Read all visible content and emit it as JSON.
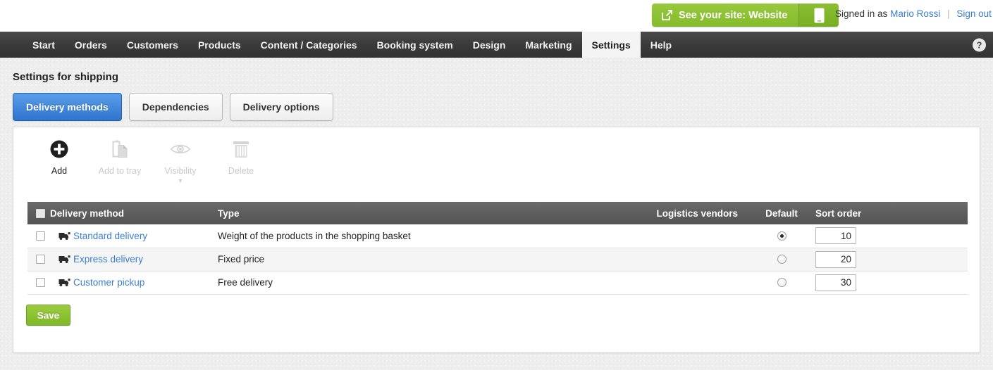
{
  "topbar": {
    "site_button_label": "See your site: Website",
    "site_button_icon": "external-link-icon",
    "mobile_button_icon": "mobile-phone-icon",
    "signed_in_prefix": "Signed in as",
    "user_name": "Mario Rossi",
    "separator": "|",
    "sign_out_label": "Sign out",
    "green": "#8cbf33"
  },
  "nav": {
    "items": [
      {
        "label": "Start",
        "active": false
      },
      {
        "label": "Orders",
        "active": false
      },
      {
        "label": "Customers",
        "active": false
      },
      {
        "label": "Products",
        "active": false
      },
      {
        "label": "Content / Categories",
        "active": false
      },
      {
        "label": "Booking system",
        "active": false
      },
      {
        "label": "Design",
        "active": false
      },
      {
        "label": "Marketing",
        "active": false
      },
      {
        "label": "Settings",
        "active": true
      },
      {
        "label": "Help",
        "active": false
      }
    ],
    "help_icon_label": "?"
  },
  "page": {
    "title": "Settings for shipping"
  },
  "tabs": [
    {
      "label": "Delivery methods",
      "active": true
    },
    {
      "label": "Dependencies",
      "active": false
    },
    {
      "label": "Delivery options",
      "active": false
    }
  ],
  "toolbar": [
    {
      "label": "Add",
      "icon": "add-circle-icon",
      "enabled": true,
      "caret": false
    },
    {
      "label": "Add to tray",
      "icon": "add-to-tray-icon",
      "enabled": false,
      "caret": false
    },
    {
      "label": "Visibility",
      "icon": "eye-icon",
      "enabled": false,
      "caret": true
    },
    {
      "label": "Delete",
      "icon": "trash-icon",
      "enabled": false,
      "caret": false
    }
  ],
  "table": {
    "headers": {
      "select_all": "",
      "delivery_method": "Delivery method",
      "type": "Type",
      "logistics_vendors": "Logistics vendors",
      "default": "Default",
      "sort_order": "Sort order"
    },
    "rows": [
      {
        "name": "Standard delivery",
        "type": "Weight of the products in the shopping basket",
        "vendors": "",
        "is_default": true,
        "sort_order": "10",
        "checked": false,
        "icon": "delivery-truck-icon"
      },
      {
        "name": "Express delivery",
        "type": "Fixed price",
        "vendors": "",
        "is_default": false,
        "sort_order": "20",
        "checked": false,
        "icon": "delivery-truck-icon"
      },
      {
        "name": "Customer pickup",
        "type": "Free delivery",
        "vendors": "",
        "is_default": false,
        "sort_order": "30",
        "checked": false,
        "icon": "delivery-truck-icon"
      }
    ]
  },
  "footer": {
    "save_label": "Save"
  }
}
